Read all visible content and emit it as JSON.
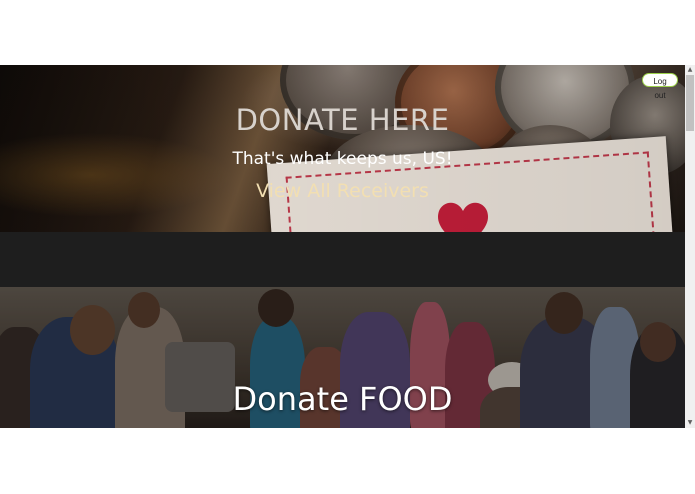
{
  "hero": {
    "title": "DONATE HERE",
    "subtitle": "That's what keeps us, US!",
    "link_label": "View All Receivers"
  },
  "header": {
    "logout_label": "Log out"
  },
  "food_section": {
    "title": "Donate FOOD"
  },
  "scrollbar": {
    "up_icon": "▲",
    "down_icon": "▼"
  },
  "colors": {
    "logout_border": "#9bd04a",
    "link_color": "#f2dfb2",
    "band": "#1e1e1e"
  }
}
